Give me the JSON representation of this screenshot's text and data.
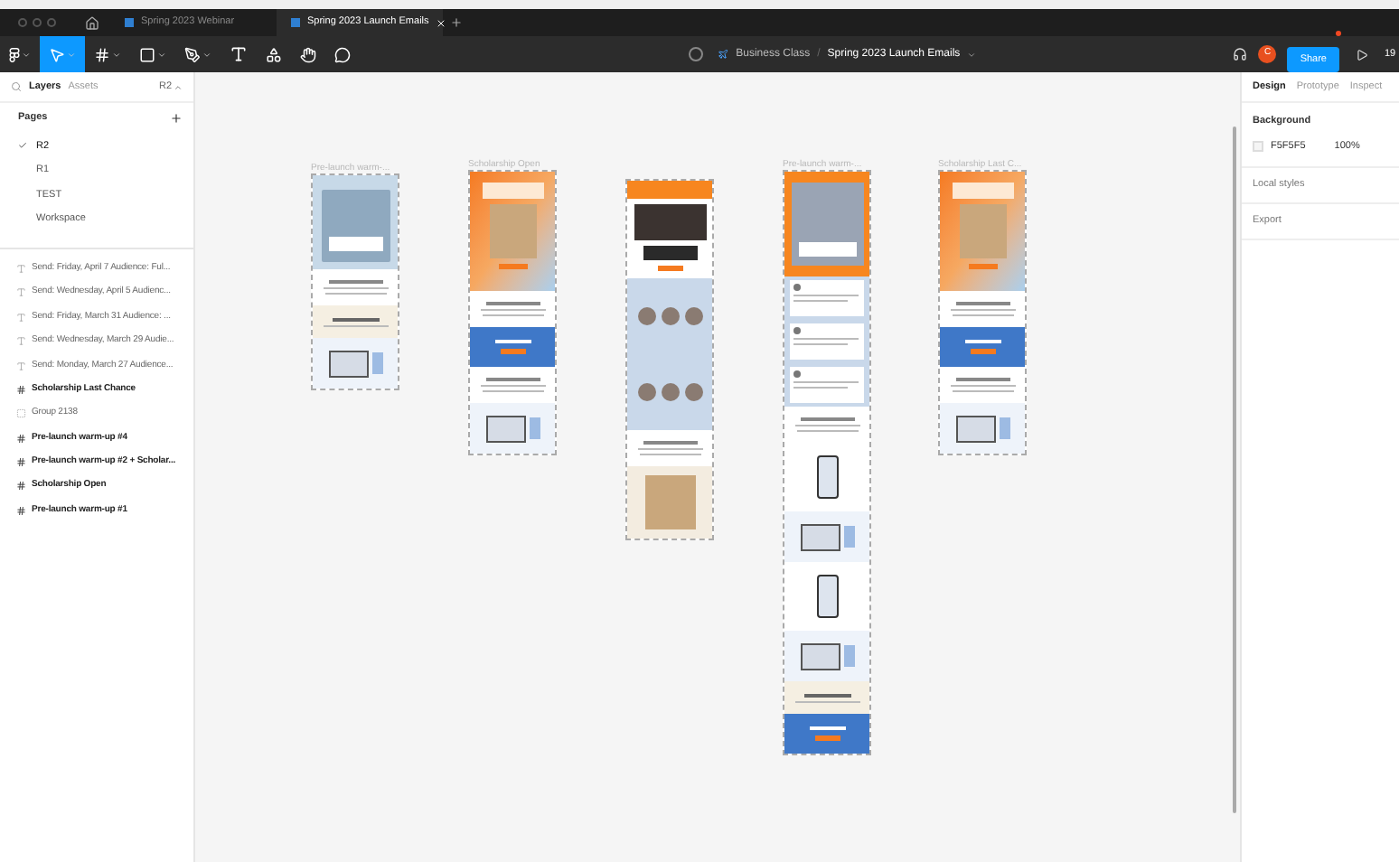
{
  "tabs": [
    {
      "label": "Spring 2023 Webinar",
      "selected": false
    },
    {
      "label": "Spring 2023 Launch Emails",
      "selected": true
    }
  ],
  "toolbar": {
    "tools": [
      {
        "kind": "menu",
        "selected": false
      },
      {
        "kind": "move",
        "selected": true
      },
      {
        "kind": "frame",
        "selected": false
      },
      {
        "kind": "shape",
        "selected": false
      },
      {
        "kind": "pen",
        "selected": false
      },
      {
        "kind": "text",
        "selected": false
      },
      {
        "kind": "components",
        "selected": false
      },
      {
        "kind": "hand",
        "selected": false
      },
      {
        "kind": "comment",
        "selected": false
      }
    ],
    "team": "Business Class",
    "separator": "/",
    "file": "Spring 2023 Launch Emails",
    "avatar": "C",
    "share": "Share",
    "zoom": "19"
  },
  "sidebar": {
    "tabs": [
      {
        "label": "Layers",
        "selected": true
      },
      {
        "label": "Assets",
        "selected": false
      }
    ],
    "page_selector": "R2",
    "pages_title": "Pages",
    "pages": [
      {
        "label": "R2",
        "selected": true
      },
      {
        "label": "R1",
        "selected": false
      },
      {
        "label": "TEST",
        "selected": false
      },
      {
        "label": "Workspace",
        "selected": false
      }
    ],
    "layers": [
      {
        "kind": "text",
        "label": "Send: Friday, April 7 Audience: Ful..."
      },
      {
        "kind": "text",
        "label": "Send: Wednesday, April 5 Audienc..."
      },
      {
        "kind": "text",
        "label": "Send: Friday, March 31 Audience: ..."
      },
      {
        "kind": "text",
        "label": "Send: Wednesday, March 29 Audie..."
      },
      {
        "kind": "text",
        "label": "Send: Monday, March 27 Audience..."
      },
      {
        "kind": "frame",
        "label": "Scholarship Last Chance"
      },
      {
        "kind": "group",
        "label": "Group 2138"
      },
      {
        "kind": "frame",
        "label": "Pre-launch warm-up #4"
      },
      {
        "kind": "frame",
        "label": "Pre-launch warm-up #2 + Scholar..."
      },
      {
        "kind": "frame",
        "label": "Scholarship Open"
      },
      {
        "kind": "frame",
        "label": "Pre-launch warm-up #1"
      }
    ]
  },
  "canvas": {
    "frames": [
      {
        "name": "Pre-launch warm-...",
        "sections": [
          {
            "kind": "photo-hero"
          },
          {
            "kind": "text-block"
          },
          {
            "kind": "beige-block"
          },
          {
            "kind": "device-image"
          }
        ]
      },
      {
        "name": "Scholarship Open",
        "sections": [
          {
            "kind": "gradient-hero"
          },
          {
            "kind": "text-block"
          },
          {
            "kind": "blue-band"
          },
          {
            "kind": "text-block"
          },
          {
            "kind": "device-image"
          }
        ]
      },
      {
        "sections": [
          {
            "kind": "orange-header"
          },
          {
            "kind": "video-hero"
          },
          {
            "kind": "avatar-grid"
          },
          {
            "kind": "avatar-grid"
          },
          {
            "kind": "text-block"
          },
          {
            "kind": "photo-block"
          }
        ]
      },
      {
        "name": "Pre-launch warm-...",
        "sections": [
          {
            "kind": "orange-photo-hero"
          },
          {
            "kind": "social-post"
          },
          {
            "kind": "social-post"
          },
          {
            "kind": "social-post"
          },
          {
            "kind": "text-block"
          },
          {
            "kind": "phone-image"
          },
          {
            "kind": "device-image"
          },
          {
            "kind": "phone-image"
          },
          {
            "kind": "device-image"
          },
          {
            "kind": "beige-block"
          },
          {
            "kind": "blue-band"
          }
        ]
      },
      {
        "name": "Scholarship Last C...",
        "sections": [
          {
            "kind": "gradient-hero"
          },
          {
            "kind": "text-block"
          },
          {
            "kind": "blue-band"
          },
          {
            "kind": "text-block"
          },
          {
            "kind": "device-image"
          }
        ]
      }
    ]
  },
  "design_panel": {
    "tabs": [
      {
        "label": "Design",
        "selected": true
      },
      {
        "label": "Prototype",
        "selected": false
      },
      {
        "label": "Inspect",
        "selected": false
      }
    ],
    "background": {
      "title": "Background",
      "hex": "F5F5F5",
      "opacity": "100%"
    },
    "sections": [
      "Local styles",
      "Export"
    ]
  }
}
